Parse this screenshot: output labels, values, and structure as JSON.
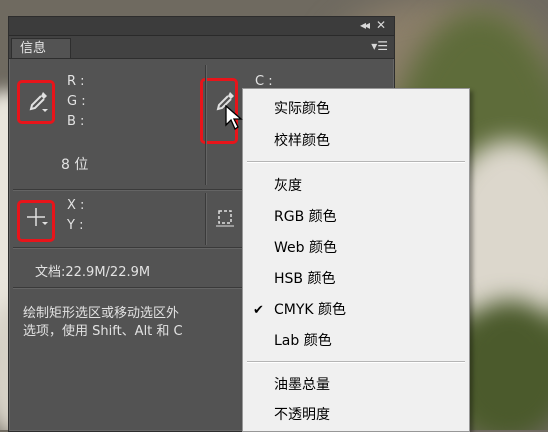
{
  "panel": {
    "tab_label": "信息",
    "collapse_icon": "double-chevron-left",
    "close_icon": "x",
    "rgb_labels": [
      "R :",
      "G :",
      "B :"
    ],
    "cmyk_label": "C :",
    "bit_depth": "8 位",
    "xy_labels": [
      "X :",
      "Y :"
    ],
    "doc_size": "文档:22.9M/22.9M",
    "hint_line1": "绘制矩形选区或移动选区外",
    "hint_line2": "选项，使用  Shift、Alt 和 C"
  },
  "menu": {
    "items": [
      {
        "label": "实际颜色",
        "checked": false
      },
      {
        "label": "校样颜色",
        "checked": false
      },
      {
        "label": "灰度",
        "checked": false
      },
      {
        "label": "RGB 颜色",
        "checked": false
      },
      {
        "label": "Web 颜色",
        "checked": false
      },
      {
        "label": "HSB 颜色",
        "checked": false
      },
      {
        "label": "CMYK 颜色",
        "checked": true
      },
      {
        "label": "Lab 颜色",
        "checked": false
      },
      {
        "label": "油墨总量",
        "checked": false
      },
      {
        "label": "不透明度",
        "checked": false
      }
    ],
    "check_glyph": "✔"
  },
  "colors": {
    "highlight": "#e8141a",
    "panel_bg": "#535353",
    "menu_bg": "#f0f0f0"
  }
}
